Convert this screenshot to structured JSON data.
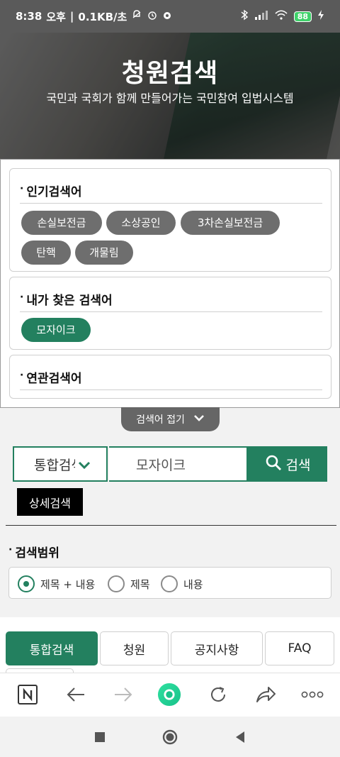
{
  "status_bar": {
    "time": "8:38",
    "ampm": "오후",
    "speed": "0.1KB/초",
    "battery": "88"
  },
  "hero": {
    "title": "청원검색",
    "subtitle": "국민과 국회가 함께 만들어가는 국민참여 입법시스템"
  },
  "popular": {
    "heading": "인기검색어",
    "keywords": [
      "손실보전금",
      "소상공인",
      "3차손실보전금",
      "탄핵",
      "개물림"
    ]
  },
  "my_searches": {
    "heading": "내가 찾은 검색어",
    "keywords": [
      "모자이크"
    ]
  },
  "related": {
    "heading": "연관검색어"
  },
  "fold": {
    "label": "검색어 접기"
  },
  "search": {
    "scope_value": "통합검색",
    "query": "모자이크",
    "button_label": "검색"
  },
  "detail_search_label": "상세검색",
  "range": {
    "heading": "검색범위",
    "options": [
      "제목 + 내용",
      "제목",
      "내용"
    ],
    "selected": "제목 + 내용"
  },
  "tabs": [
    "통합검색",
    "청원",
    "공지사항",
    "FAQ"
  ],
  "active_tab": "통합검색",
  "browser_toolbar": {
    "icons": [
      "naver-icon",
      "back-icon",
      "forward-icon",
      "green-dot-icon",
      "refresh-icon",
      "share-icon",
      "more-icon"
    ]
  },
  "colors": {
    "accent": "#23805f",
    "chip": "#6e6e6e"
  }
}
